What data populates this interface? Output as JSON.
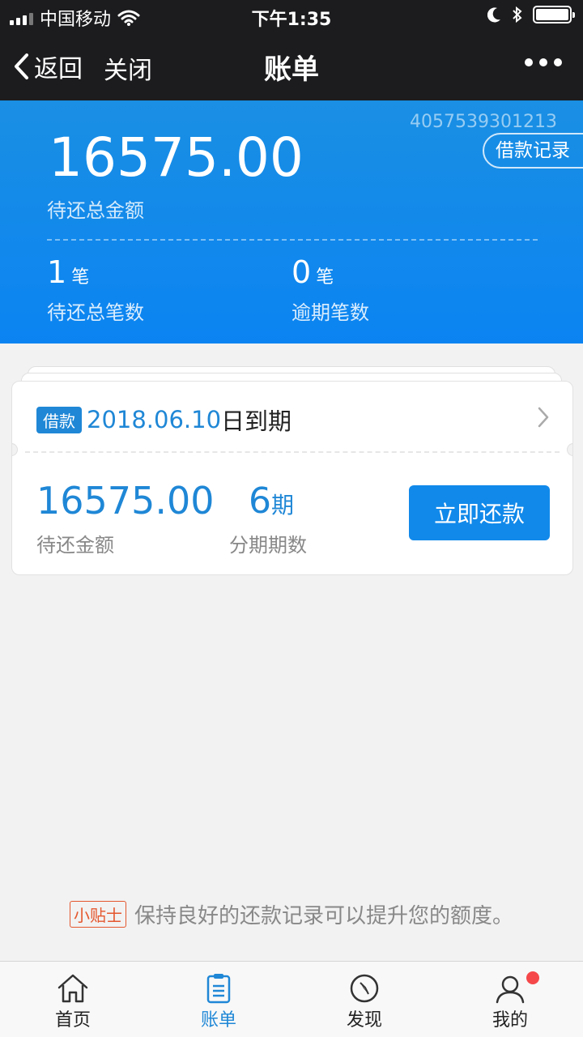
{
  "status_bar": {
    "carrier": "中国移动",
    "time": "下午1:35"
  },
  "nav": {
    "back_label": "返回",
    "close_label": "关闭",
    "title": "账单"
  },
  "summary": {
    "account_number": "4057539301213",
    "records_button": "借款记录",
    "total_amount": "16575.00",
    "total_label": "待还总金额",
    "pending_count": "1",
    "pending_unit": "笔",
    "pending_label": "待还总笔数",
    "overdue_count": "0",
    "overdue_unit": "笔",
    "overdue_label": "逾期笔数"
  },
  "bill": {
    "tag": "借款",
    "due_date": "2018.06.10",
    "due_suffix": "日到期",
    "amount": "16575.00",
    "amount_label": "待还金额",
    "periods": "6",
    "periods_unit": "期",
    "periods_label": "分期期数",
    "repay_button": "立即还款"
  },
  "tip": {
    "badge": "小贴士",
    "text": "保持良好的还款记录可以提升您的额度。"
  },
  "tabs": [
    {
      "label": "首页",
      "icon": "home-icon"
    },
    {
      "label": "账单",
      "icon": "bill-icon"
    },
    {
      "label": "发现",
      "icon": "compass-icon"
    },
    {
      "label": "我的",
      "icon": "user-icon"
    }
  ],
  "colors": {
    "accent": "#1f87d6",
    "header_gradient_start": "#1a8fe3",
    "header_gradient_end": "#0b84f2",
    "tip_badge": "#e4572e",
    "notification_dot": "#f5484a"
  }
}
